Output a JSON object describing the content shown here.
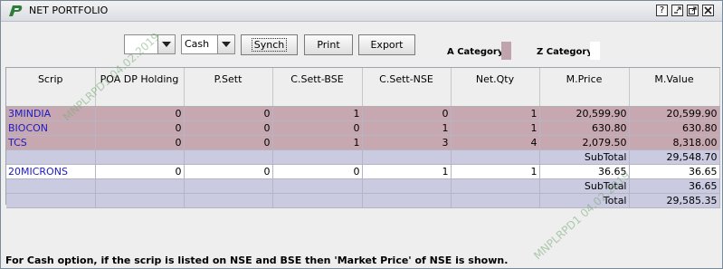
{
  "window": {
    "title": "NET PORTFOLIO"
  },
  "toolbar": {
    "combo1_value": "",
    "combo2_value": "Cash",
    "synch_label": "Synch",
    "print_label": "Print",
    "export_label": "Export",
    "a_category_label": "A Category",
    "z_category_label": "Z Category",
    "a_category_color": "#C0A3AC",
    "z_category_color": "#FFFFFF"
  },
  "table": {
    "headers": {
      "scrip": "Scrip",
      "poa": "POA DP Holding",
      "psett": "P.Sett",
      "csettbse": "C.Sett-BSE",
      "csettnse": "C.Sett-NSE",
      "netqty": "Net.Qty",
      "mprice": "M.Price",
      "mvalue": "M.Value"
    },
    "rows": [
      {
        "scrip": "3MINDIA",
        "poa": "0",
        "psett": "0",
        "csettbse": "1",
        "csettnse": "0",
        "netqty": "1",
        "mprice": "20,599.90",
        "mvalue": "20,599.90"
      },
      {
        "scrip": "BIOCON",
        "poa": "0",
        "psett": "0",
        "csettbse": "0",
        "csettnse": "1",
        "netqty": "1",
        "mprice": "630.80",
        "mvalue": "630.80"
      },
      {
        "scrip": "TCS",
        "poa": "0",
        "psett": "0",
        "csettbse": "1",
        "csettnse": "3",
        "netqty": "4",
        "mprice": "2,079.50",
        "mvalue": "8,318.00"
      },
      {
        "mprice": "SubTotal",
        "mvalue": "29,548.70"
      },
      {
        "scrip": "20MICRONS",
        "poa": "0",
        "psett": "0",
        "csettbse": "0",
        "csettnse": "1",
        "netqty": "1",
        "mprice": "36.65",
        "mvalue": "36.65"
      },
      {
        "mprice": "SubTotal",
        "mvalue": "36.65"
      },
      {
        "mprice": "Total",
        "mvalue": "29,585.35"
      }
    ]
  },
  "watermark": {
    "text1": "MNPLRPD1 04.02.2019",
    "text2": "MNPLRPD1 04.02.2019"
  },
  "footer": {
    "note": "For Cash option, if the scrip is listed on NSE and BSE then 'Market Price' of NSE is shown."
  }
}
